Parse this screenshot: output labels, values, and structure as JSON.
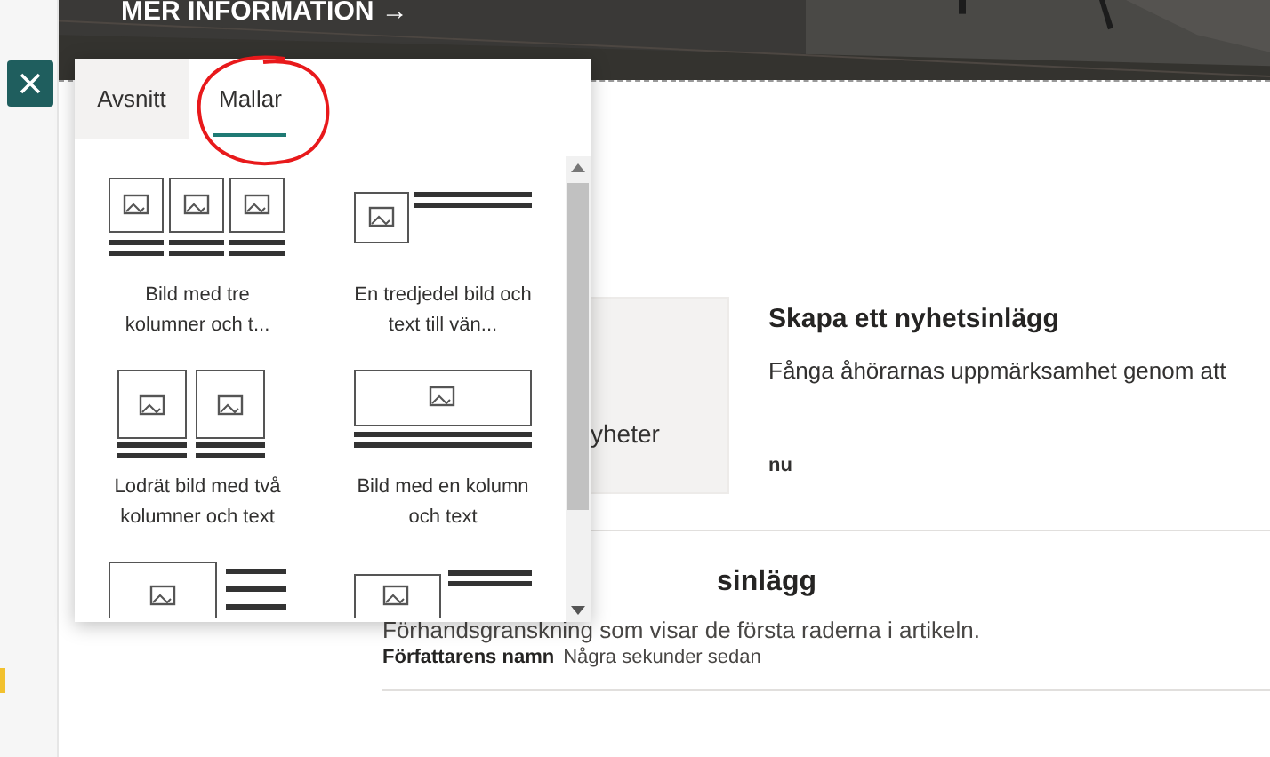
{
  "hero": {
    "link": "MER INFORMATION →"
  },
  "panel": {
    "tabs": [
      {
        "label": "Avsnitt",
        "selected": false
      },
      {
        "label": "Mallar",
        "selected": true
      }
    ],
    "templates": [
      {
        "kind": "three-columns",
        "label": "Bild med tre kolumner och t..."
      },
      {
        "kind": "third-left",
        "label": "En tredjedel bild och text till vän..."
      },
      {
        "kind": "two-columns",
        "label": "Lodrät bild med två kolumner och text"
      },
      {
        "kind": "one-column",
        "label": "Bild med en kolumn och text"
      },
      {
        "kind": "large-left"
      },
      {
        "kind": "small-left"
      }
    ]
  },
  "news": [
    {
      "thumbnail_text": "yheter",
      "title": "Skapa ett nyhetsinlägg",
      "description": "Fånga åhörarnas uppmärksamhet genom att",
      "meta": "nu"
    },
    {
      "title": "sinlägg",
      "description": "Förhandsgranskning som visar de första raderna i artikeln.",
      "author": "Författarens namn",
      "time": "Några sekunder sedan"
    }
  ]
}
